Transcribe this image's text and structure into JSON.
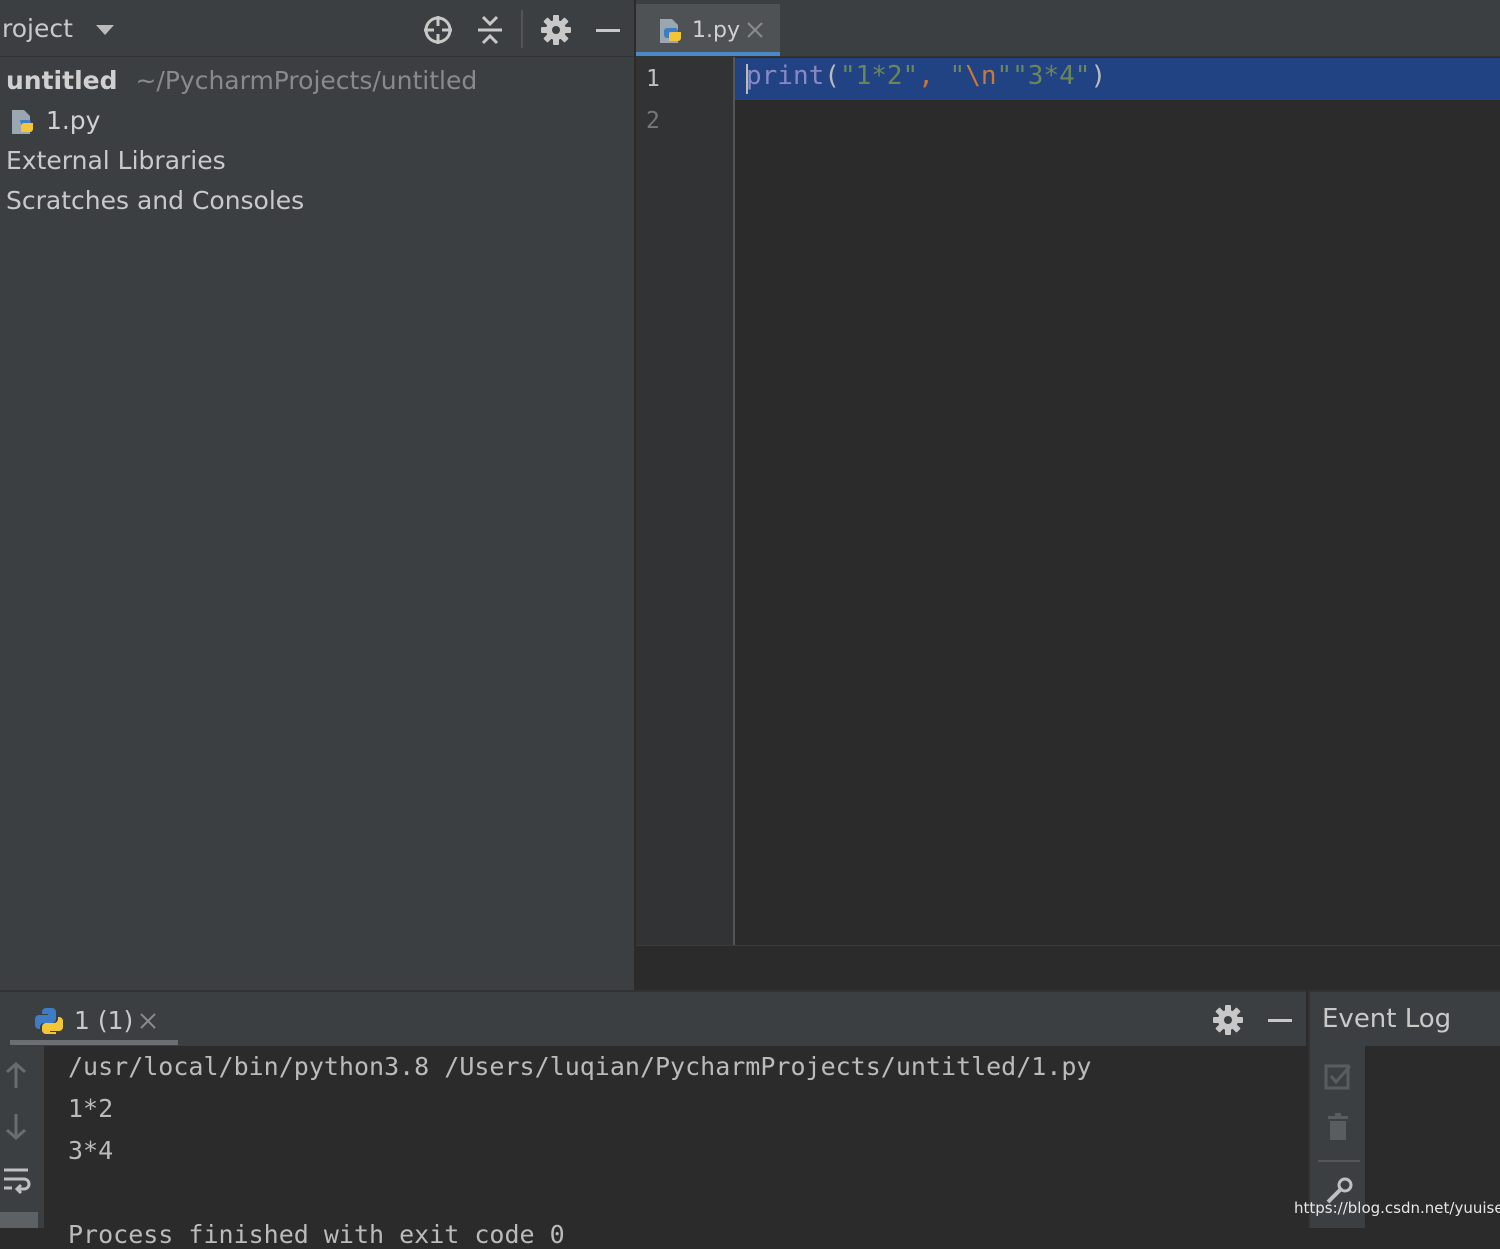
{
  "project_panel": {
    "title": "roject",
    "tree": {
      "root_name": "untitled",
      "root_path": "~/PycharmProjects/untitled",
      "file": "1.py",
      "external_libraries": "External Libraries",
      "scratches": "Scratches and Consoles"
    },
    "tools": [
      "locate-icon",
      "collapse-all-icon",
      "gear-icon",
      "minimize-icon"
    ]
  },
  "editor": {
    "tab_label": "1.py",
    "line_numbers": [
      "1",
      "2"
    ],
    "code": {
      "fn": "print",
      "open": "(",
      "str1": "\"1*2\"",
      "comma": ",",
      "str2_open": " \"",
      "escape": "\\n",
      "str2_close": "\"",
      "str3": "\"3*4\"",
      "close": ")"
    }
  },
  "run_panel": {
    "tab_label": "1 (1)",
    "console_lines": [
      "/usr/local/bin/python3.8 /Users/luqian/PycharmProjects/untitled/1.py",
      "1*2",
      "3*4",
      "",
      "Process finished with exit code 0"
    ]
  },
  "event_log": {
    "title": "Event Log"
  },
  "watermark": "https://blog.csdn.net/yuuisei",
  "colors": {
    "panel_bg": "#3c3f41",
    "editor_bg": "#2b2b2b",
    "selection": "#214283",
    "keyword_fn": "#8888c6",
    "string": "#6a8759",
    "escape": "#cc7832",
    "tab_accent": "#4a88c7"
  }
}
